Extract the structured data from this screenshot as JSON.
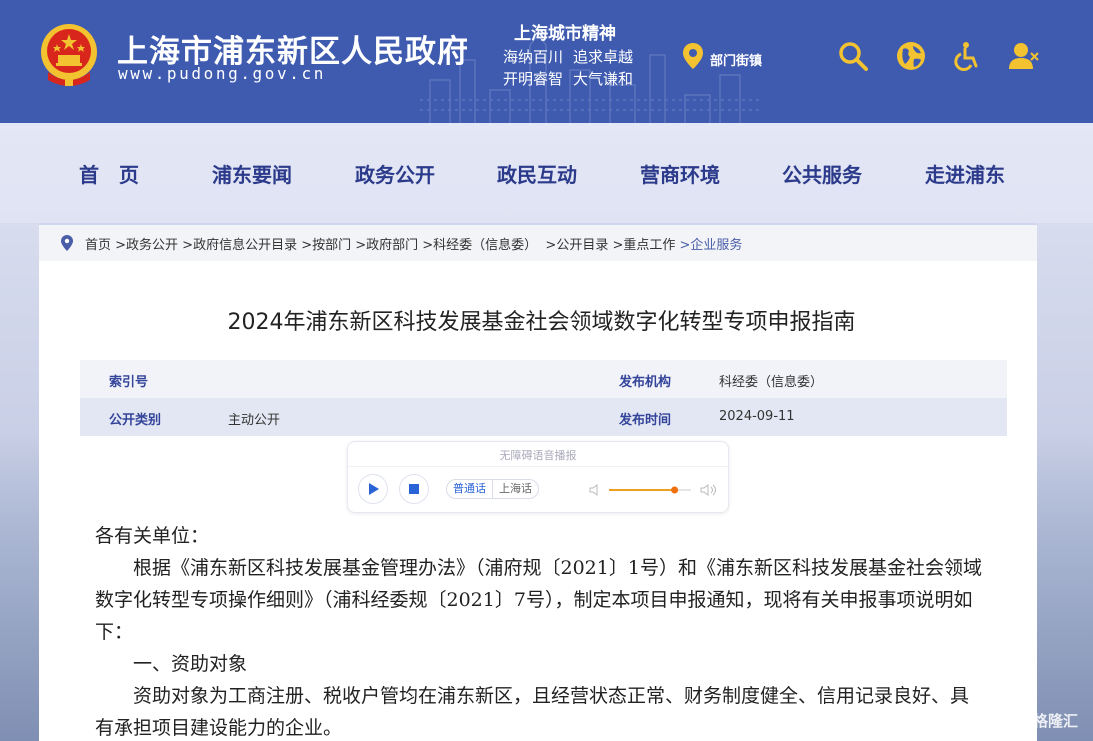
{
  "header": {
    "site_title": "上海市浦东新区人民政府",
    "site_url": "www.pudong.gov.cn",
    "spirit_title": "上海城市精神",
    "spirit_lines": [
      "海纳百川",
      "追求卓越",
      "开明睿智",
      "大气谦和"
    ],
    "dept_label": "部门街镇",
    "icons": [
      "search-icon",
      "globe-icon",
      "accessibility-icon",
      "user-icon"
    ]
  },
  "nav": {
    "items": [
      "首　页",
      "浦东要闻",
      "政务公开",
      "政民互动",
      "营商环境",
      "公共服务",
      "走进浦东"
    ]
  },
  "breadcrumb": {
    "items": [
      "首页",
      " >政务公开",
      " >政府信息公开目录",
      " >按部门",
      " >政府部门",
      " >科经委（信息委）",
      "  >公开目录",
      " >重点工作",
      " >企业服务"
    ]
  },
  "document": {
    "title": "2024年浦东新区科技发展基金社会领域数字化转型专项申报指南",
    "meta": {
      "index_label": "索引号",
      "index_value": "",
      "publisher_label": "发布机构",
      "publisher_value": "科经委（信息委）",
      "category_label": "公开类别",
      "category_value": "主动公开",
      "date_label": "发布时间",
      "date_value": "2024-09-11"
    }
  },
  "player": {
    "title": "无障碍语音播报",
    "lang_mandarin": "普通话",
    "lang_shanghai": "上海话",
    "volume_level": 0.8
  },
  "body": {
    "greeting": "各有关单位：",
    "para1": "根据《浦东新区科技发展基金管理办法》（浦府规〔2021〕1号）和《浦东新区科技发展基金社会领域数字化转型专项操作细则》（浦科经委规〔2021〕7号），制定本项目申报通知，现将有关申报事项说明如下：",
    "section1": "一、资助对象",
    "para2": "资助对象为工商注册、税收户管均在浦东新区，且经营状态正常、财务制度健全、信用记录良好、具有承担项目建设能力的企业。"
  },
  "watermark": "格隆汇",
  "colors": {
    "header_bg": "#3f5bb0",
    "nav_text": "#2b3a8a",
    "emblem_red": "#d8261c",
    "emblem_gold": "#f2c230",
    "meta_label": "#34449a"
  }
}
